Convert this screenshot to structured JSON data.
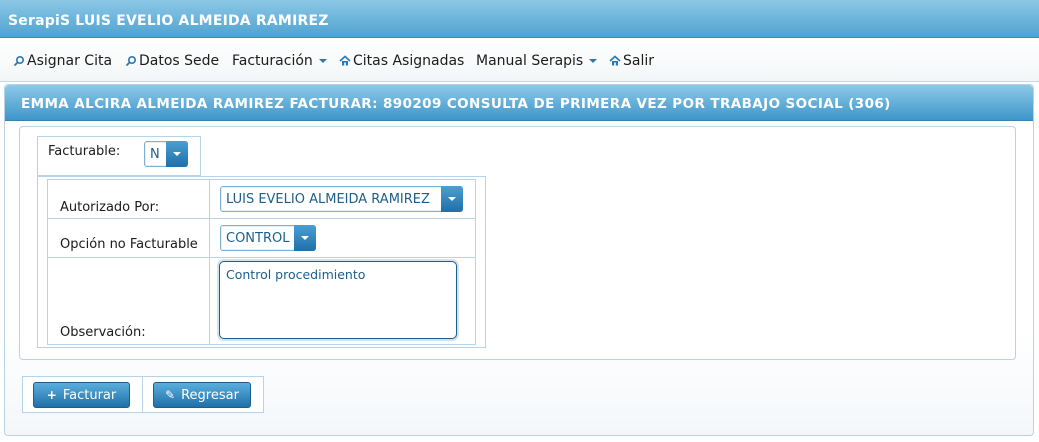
{
  "app": {
    "title": "SerapiS LUIS EVELIO ALMEIDA RAMIREZ"
  },
  "menu": {
    "items": [
      {
        "label": "Asignar Cita",
        "icon": "search-icon"
      },
      {
        "label": "Datos Sede",
        "icon": "search-icon"
      },
      {
        "label": "Facturación",
        "icon": "caret-down-icon"
      },
      {
        "label": "Citas Asignadas",
        "icon": "home-icon"
      },
      {
        "label": "Manual Serapis",
        "icon": "caret-down-icon"
      },
      {
        "label": "Salir",
        "icon": "home-icon"
      }
    ]
  },
  "panel": {
    "title": "EMMA ALCIRA ALMEIDA RAMIREZ FACTURAR: 890209 CONSULTA DE PRIMERA VEZ POR TRABAJO SOCIAL (306)"
  },
  "form": {
    "facturable": {
      "label": "Facturable:",
      "value": "N"
    },
    "autorizado": {
      "label": "Autorizado Por:",
      "value": "LUIS EVELIO ALMEIDA RAMIREZ"
    },
    "opcion": {
      "label": "Opción no Facturable",
      "value": "CONTROL"
    },
    "observacion": {
      "label": "Observación:",
      "value": "Control procedimiento"
    }
  },
  "actions": {
    "facturar": "Facturar",
    "regresar": "Regresar"
  },
  "colors": {
    "header": "#4fa3d1",
    "accent": "#1f70aa",
    "text_link": "#1d5f8a"
  }
}
